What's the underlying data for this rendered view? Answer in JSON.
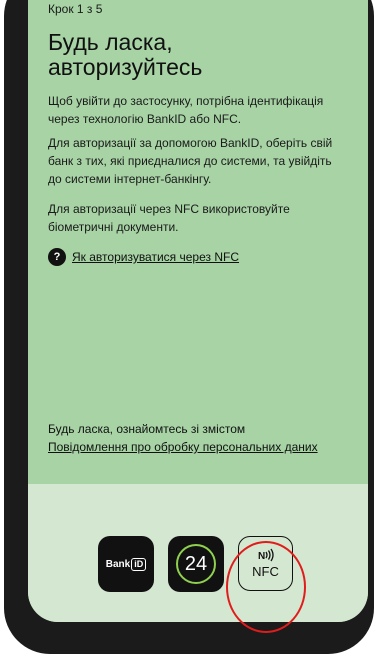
{
  "header": {
    "step": "Крок 1 з 5",
    "title": "Будь ласка, авторизуйтесь"
  },
  "body": {
    "paragraph_1": "Щоб увійти до застосунку, потрібна ідентифікація через технологію BankID або NFC.",
    "paragraph_2": "Для авторизації за допомогою BankID, оберіть свій банк з тих, які приєдналися до системи, та увійдіть до системи інтернет-банкінгу.",
    "paragraph_3": "Для авторизації через NFC використовуйте біометричні документи.",
    "help_icon": "?",
    "help_link": "Як авторизуватися через NFC"
  },
  "footer": {
    "notice": "Будь ласка, ознайомтесь зі змістом",
    "notice_link": "Повідомлення про обробку персональних даних"
  },
  "auth_options": {
    "bankid_text": "Bank",
    "bankid_box": "iD",
    "privat_text": "24",
    "nfc_text": "NFC"
  },
  "colors": {
    "screen_bg": "#a7d3a5",
    "bottom_bg": "#d4e7d0",
    "highlight": "#e01c1c",
    "privat_ring": "#8fd14f"
  }
}
